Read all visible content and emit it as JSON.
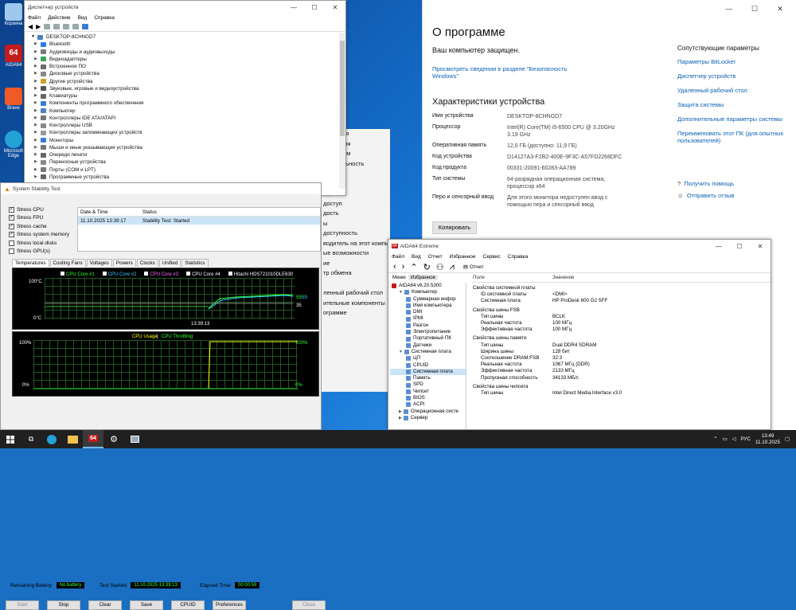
{
  "desktop": {
    "icons": [
      {
        "label": "Корзина",
        "color": "#9ec8ee"
      },
      {
        "label": "AIDA64",
        "color": "#c31c1c"
      },
      {
        "label": "Brave",
        "color": "#f05a24"
      },
      {
        "label": "Microsoft Edge",
        "color": "#23a2d6"
      }
    ]
  },
  "settings": {
    "title": "О программе",
    "protected": "Ваш компьютер защищен.",
    "security_link": "Просмотреть сведения в разделе \"Безопасность Windows\"",
    "specs_title": "Характеристики устройства",
    "specs": [
      {
        "k": "Имя устройства",
        "v": "DESKTOP-8CHNGD7"
      },
      {
        "k": "Процессор",
        "v": "Intel(R) Core(TM) i5-6500 CPU @ 3.20GHz 3.19 GHz"
      },
      {
        "k": "Оперативная память",
        "v": "12,0 ГБ (доступно: 11,9 ГБ)"
      },
      {
        "k": "Код устройства",
        "v": "D14127A3-F2B2-400E-9F3C-A57FD2268DFC"
      },
      {
        "k": "Код продукта",
        "v": "00331-20091-60283-AA789"
      },
      {
        "k": "Тип системы",
        "v": "64-разрядная операционная система, процессор x64"
      },
      {
        "k": "Перо и сенсорный ввод",
        "v": "Для этого монитора недоступен ввод с помощью пера и сенсорный ввод"
      }
    ],
    "copy": "Копировать",
    "related_title": "Сопутствующие параметры",
    "related": [
      "Параметры BitLocker",
      "Диспетчер устройств",
      "Удаленный рабочий стол",
      "Защита системы",
      "Дополнительные параметры системы",
      "Переименовать этот ПК (для опытных пользователей)"
    ],
    "help": [
      "Получить помощь",
      "Отправить отзыв"
    ],
    "bg_items": [
      "действия",
      "анимация",
      "ый режим",
      "водительность",
      "тности",
      "ивность",
      "одная",
      "доступ",
      "дость",
      "ы",
      "доступность",
      "водитель на этот компьютер",
      "ые возможности",
      "ие",
      "тр обмена",
      "",
      "ленный рабочий стол",
      "ительные компоненты",
      "ограмме"
    ]
  },
  "devmgr": {
    "title": "Диспетчер устройств",
    "menu": [
      "Файл",
      "Действие",
      "Вид",
      "Справка"
    ],
    "root": "DESKTOP-8CHNGD7",
    "items": [
      "Bluetooth",
      "Аудиовходы и аудиовыходы",
      "Видеоадаптеры",
      "Встроенное ПО",
      "Дисковые устройства",
      "Другие устройства",
      "Звуковые, игровые и видеоустройства",
      "Клавиатуры",
      "Компоненты программного обеспечения",
      "Компьютер",
      "Контроллеры IDE ATA/ATAPI",
      "Контроллеры USB",
      "Контроллеры запоминающих устройств",
      "Мониторы",
      "Мыши и иные указывающие устройства",
      "Очереди печати",
      "Переносные устройства",
      "Порты (COM и LPT)",
      "Программные устройства"
    ]
  },
  "stability": {
    "title": "System Stability Test",
    "checks": [
      {
        "l": "Stress CPU",
        "c": true
      },
      {
        "l": "Stress FPU",
        "c": true
      },
      {
        "l": "Stress cache",
        "c": true
      },
      {
        "l": "Stress system memory",
        "c": true
      },
      {
        "l": "Stress local disks",
        "c": false
      },
      {
        "l": "Stress GPU(s)",
        "c": false
      }
    ],
    "evt_head": [
      "Date & Time",
      "Status"
    ],
    "evt_row": [
      "11.10.2025 13:39:17",
      "Stability Test: Started"
    ],
    "tabs": [
      "Temperatures",
      "Cooling Fans",
      "Voltages",
      "Powers",
      "Clocks",
      "Unified",
      "Statistics"
    ],
    "legend": [
      {
        "n": "CPU Core #1",
        "c": "#33ff33"
      },
      {
        "n": "CPU Core #2",
        "c": "#33ccff"
      },
      {
        "n": "CPU Core #3",
        "c": "#ff66ff"
      },
      {
        "n": "CPU Core #4",
        "c": "#ffffff"
      },
      {
        "n": "Hitachi HDS721010DLE630",
        "c": "#ffffff"
      }
    ],
    "t_top": "100°C",
    "t_bot": "0°C",
    "t_time": "13:39:13",
    "t_val1": "59",
    "t_val2": "59",
    "t_val3": "35",
    "u_title": "CPU Usage",
    "u_sep": "|",
    "u_title2": "CPU Throttling",
    "u_top": "100%",
    "u_bot": "0%",
    "u_rtop": "100%",
    "u_rbot": "0%",
    "rem_label": "Remaining Battery:",
    "rem_val": "No battery",
    "start_label": "Test Started:",
    "start_val": "11.10.2025 13:39:13",
    "elapsed_label": "Elapsed Time:",
    "elapsed_val": "00:00:59",
    "buttons": [
      "Start",
      "Stop",
      "Clear",
      "Save",
      "CPUID",
      "Preferences",
      "Close"
    ]
  },
  "aida": {
    "title": "AIDA64 Extreme",
    "menu": [
      "Файл",
      "Вид",
      "Отчет",
      "Избранное",
      "Сервис",
      "Справка"
    ],
    "report": "Отчет",
    "tab_menu": "Меню",
    "tab_fav": "Избранное",
    "tree": [
      {
        "l": "AIDA64 v6.20.5300",
        "d": 0
      },
      {
        "l": "Компьютер",
        "d": 1
      },
      {
        "l": "Суммарная инфор",
        "d": 2
      },
      {
        "l": "Имя компьютера",
        "d": 2
      },
      {
        "l": "DMI",
        "d": 2
      },
      {
        "l": "IPMI",
        "d": 2
      },
      {
        "l": "Разгон",
        "d": 2
      },
      {
        "l": "Электропитание",
        "d": 2
      },
      {
        "l": "Портативный ПК",
        "d": 2
      },
      {
        "l": "Датчики",
        "d": 2
      },
      {
        "l": "Системная плата",
        "d": 1
      },
      {
        "l": "ЦП",
        "d": 2
      },
      {
        "l": "CPUID",
        "d": 2
      },
      {
        "l": "Системная плата",
        "d": 2
      },
      {
        "l": "Память",
        "d": 2
      },
      {
        "l": "SPD",
        "d": 2
      },
      {
        "l": "Чипсет",
        "d": 2
      },
      {
        "l": "BIOS",
        "d": 2
      },
      {
        "l": "ACPI",
        "d": 2
      },
      {
        "l": "Операционная систе",
        "d": 1
      },
      {
        "l": "Сервер",
        "d": 1
      }
    ],
    "col_field": "Поле",
    "col_value": "Значение",
    "rows": [
      {
        "s": true,
        "f": "Свойства системной платы"
      },
      {
        "f": "ID системной платы",
        "v": "<DMI>"
      },
      {
        "f": "Системная плата",
        "v": "HP ProDesk 600 G2 SFF"
      },
      {
        "s": true,
        "f": "Свойства шины FSB"
      },
      {
        "f": "Тип шины",
        "v": "BCLK"
      },
      {
        "f": "Реальная частота",
        "v": "100 МГц"
      },
      {
        "f": "Эффективная частота",
        "v": "100 МГц"
      },
      {
        "s": true,
        "f": "Свойства шины памяти"
      },
      {
        "f": "Тип шины",
        "v": "Dual DDR4 SDRAM"
      },
      {
        "f": "Ширина шины",
        "v": "128 бит"
      },
      {
        "f": "Соотношение DRAM:FSB",
        "v": "32:3"
      },
      {
        "f": "Реальная частота",
        "v": "1067 МГц (DDR)"
      },
      {
        "f": "Эффективная частота",
        "v": "2133 МГц"
      },
      {
        "f": "Пропускная способность",
        "v": "34133 МБ/с"
      },
      {
        "s": true,
        "f": "Свойства шины чипсета"
      },
      {
        "f": "Тип шины",
        "v": "Intel Direct Media Interface v3.0"
      }
    ]
  },
  "taskbar": {
    "lang": "РУС",
    "time": "13:49",
    "date": "11.10.2025"
  }
}
